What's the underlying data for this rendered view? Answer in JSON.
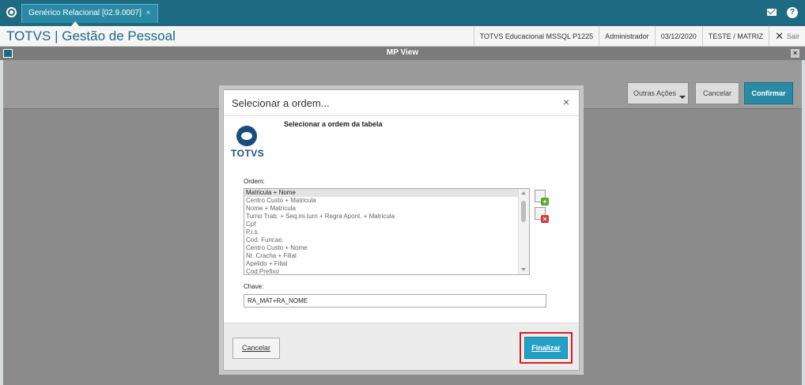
{
  "topbar": {
    "tab_label": "Genérico Relacional [02.9.0007]",
    "tab_close": "×",
    "help_glyph": "?"
  },
  "header": {
    "app_title": "TOTVS | Gestão de Pessoal",
    "environment": "TOTVS Educacional MSSQL P1225",
    "user": "Administrador",
    "date": "03/12/2020",
    "branch": "TESTE / MATRIZ",
    "exit_label": "Sair"
  },
  "mpview": {
    "title": "MP View",
    "close": "×"
  },
  "toolbar": {
    "outras_acoes": "Outras Ações",
    "cancelar": "Cancelar",
    "confirmar": "Confirmar"
  },
  "modal": {
    "title": "Selecionar a ordem...",
    "close": "×",
    "subtitle": "Selecionar a ordem da tabela",
    "logo_text": "TOTVS",
    "ordem_label": "Ordem:",
    "ordem_items": [
      "Matricula + Nome",
      "Centro Custo + Matricula",
      "Nome + Matricula",
      "Turno Trab. + Seq.ini.turn + Regra Apont. + Matricula",
      "Cpf",
      "P.i.s.",
      "Cod. Funcao",
      "Centro Custo + Nome",
      "Nr. Cracha + Filial",
      "Apelido + Filial",
      "Cod.Prefixo"
    ],
    "chave_label": "Chave:",
    "chave_value": "RA_MAT+RA_NOME",
    "cancelar_label": "Cancelar",
    "finalizar_label": "Finalizar"
  }
}
